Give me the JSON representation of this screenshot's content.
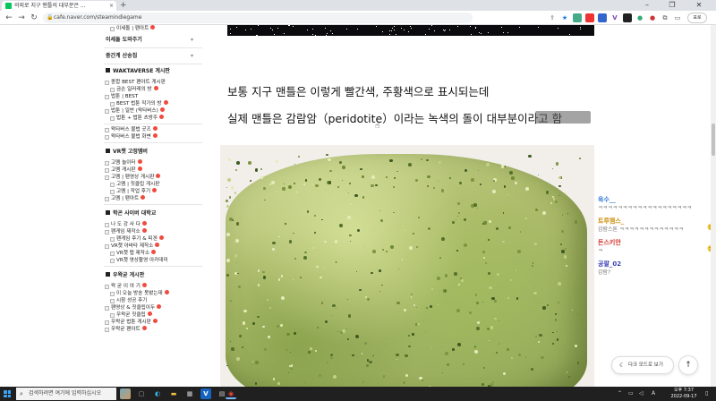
{
  "browser": {
    "tab_title": "의외로 지구 맨틀의 대부분은 ...",
    "tab_close": "×",
    "new_tab": "+",
    "url": "cafe.naver.com/steamindiegame",
    "profile_label": "표로",
    "minimize": "–",
    "restore": "❐",
    "close": "✕"
  },
  "sidebar": {
    "items": [
      {
        "label": "이세돌 | 팬아트",
        "cls": "sub",
        "new": true
      },
      {
        "label": "이세돌 도와주기",
        "type": "fold"
      },
      {
        "label": "중간계 산송집",
        "type": "fold"
      },
      {
        "label": "WAKTAVERSE 게시판",
        "type": "head"
      },
      {
        "label": "종합 BEST 팬아트 게시판",
        "cls": "",
        "new": false
      },
      {
        "label": "금손 일러레의 방",
        "cls": "sub",
        "new": true
      },
      {
        "label": "법툰 | BEST",
        "cls": "",
        "new": false
      },
      {
        "label": "BEST 법툰 작가의 방",
        "cls": "sub",
        "new": true
      },
      {
        "label": "법툰 | 일반 (왁타버스)",
        "cls": "",
        "new": true
      },
      {
        "label": "법툰 + 법툰 츠방주",
        "cls": "sub",
        "new": true
      },
      {
        "type": "sep"
      },
      {
        "label": "왁타버스 불법 굿즈",
        "cls": "",
        "new": true
      },
      {
        "label": "왁타버스 불법 화변",
        "cls": "",
        "new": true
      },
      {
        "type": "sep"
      },
      {
        "label": "VR챗 고정멤버",
        "type": "head"
      },
      {
        "label": "고멤 놀이터",
        "cls": "",
        "new": true
      },
      {
        "label": "고멤 게시판",
        "cls": "",
        "new": true
      },
      {
        "label": "고멤 | 팬영상 게시판",
        "cls": "",
        "new": true
      },
      {
        "label": "고멤 | 짓클립 게시판",
        "cls": "sub",
        "new": false
      },
      {
        "label": "고멤 | 작업 후기",
        "cls": "sub",
        "new": true
      },
      {
        "label": "고멤 | 팬아트",
        "cls": "",
        "new": true
      },
      {
        "type": "sep"
      },
      {
        "label": "학굔 사이버 대학교",
        "type": "head"
      },
      {
        "label": "나 도 강 사 다",
        "cls": "",
        "new": true
      },
      {
        "label": "팬게임 제작소",
        "cls": "",
        "new": true
      },
      {
        "label": "팬게임 후기 & 피겐",
        "cls": "sub",
        "new": true
      },
      {
        "label": "VR챗 아바타 제작소",
        "cls": "",
        "new": true
      },
      {
        "label": "VR챗 맵 제작소",
        "cls": "sub",
        "new": true
      },
      {
        "label": "VR챗 영상촬영 아카데미",
        "cls": "sub",
        "new": false
      },
      {
        "type": "sep"
      },
      {
        "label": "우왁굳 게시판",
        "type": "head"
      },
      {
        "label": "왁 굳 이 야 기",
        "cls": "",
        "new": true
      },
      {
        "label": "이 오늘 방송 못봤는데",
        "cls": "sub",
        "new": true
      },
      {
        "label": "시참 성공 후기",
        "cls": "sub",
        "new": false
      },
      {
        "label": "팬영상 & 짓클립이두",
        "cls": "",
        "new": true
      },
      {
        "label": "우왁굳 짓클립",
        "cls": "sub",
        "new": true
      },
      {
        "label": "우왁굳 법툰 게시판",
        "cls": "",
        "new": true
      },
      {
        "label": "우왁굳 팬아트",
        "cls": "",
        "new": true
      }
    ]
  },
  "article": {
    "line1": "보통 지구 맨틀은 이렇게 빨간색, 주황색으로 표시되는데",
    "line2": "실제 맨틀은 감람암（peridotite）이라는 녹색의 돌이 대부분이라고 함"
  },
  "chat": {
    "messages": [
      {
        "name": "육수__",
        "name_color": "#3a7bd5",
        "text": "ㅋㅋㅋㅋㅋㅋㅋㅋㅋㅋㅋㅋㅋㅋㅋㅋㅋㅋㅋ",
        "emo": ""
      },
      {
        "name": "트루멤스_",
        "name_color": "#c98a00",
        "text": "감람스톤 ㅋㅋㅋㅋㅋㅋㅋㅋㅋㅋㅋㅋㅋ",
        "emo": "🙂"
      },
      {
        "name": "돈스키안",
        "name_color": "#d0342c",
        "text": "ㅋ",
        "emo": "🙂"
      },
      {
        "name": "공팔_02",
        "name_color": "#3a3fb5",
        "text": "감람?",
        "emo": ""
      }
    ],
    "dark_mode_label": "다크 모드로 보기",
    "top_label": "↑"
  },
  "taskbar": {
    "search_placeholder": "검색하려면 여기에 입력하십시오",
    "time": "오후 7:37",
    "date": "2022-09-17",
    "lang": "A"
  }
}
